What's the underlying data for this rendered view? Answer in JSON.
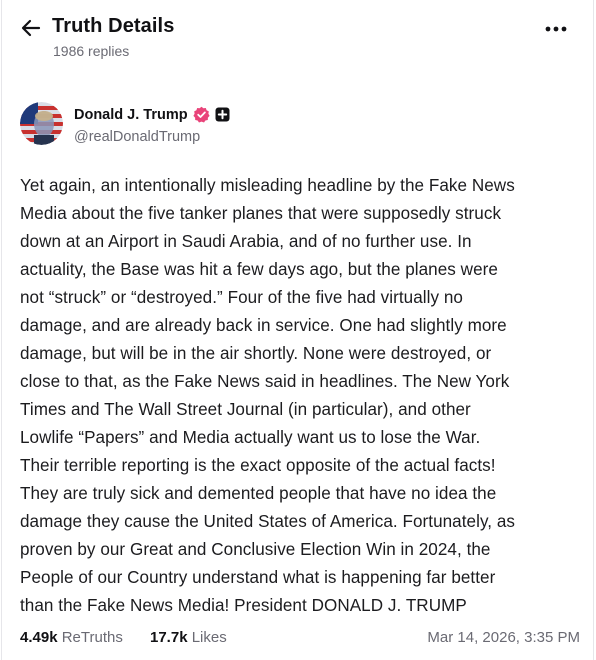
{
  "header": {
    "title": "Truth Details",
    "reply_count": "1986 replies"
  },
  "author": {
    "name": "Donald J. Trump",
    "handle": "@realDonaldTrump"
  },
  "post": {
    "lines": [
      "Yet again, an intentionally misleading headline by the Fake News",
      "Media about the five tanker planes that were supposedly struck",
      "down at an Airport in Saudi Arabia, and of no further use. In",
      "actuality, the Base was hit a few days ago, but the planes were",
      "not “struck” or “destroyed.” Four of the five had virtually no",
      "damage, and are already back in service. One had slightly more",
      "damage, but will be in the air shortly. None were destroyed, or",
      "close to that, as the Fake News said in headlines. The New York",
      "Times and The Wall Street Journal (in particular), and other",
      "Lowlife “Papers” and Media actually want us to lose the War.",
      "Their terrible reporting is the exact opposite of the actual facts!",
      "They are truly sick and demented people that have no idea the",
      "damage they cause the United States of America. Fortunately, as",
      "proven by our Great and Conclusive Election Win in 2024, the",
      "People of our Country understand what is happening far better",
      "than the Fake News Media! President DONALD J. TRUMP"
    ]
  },
  "stats": {
    "retruths_count": "4.49k",
    "retruths_label": "ReTruths",
    "likes_count": "17.7k",
    "likes_label": "Likes",
    "timestamp": "Mar 14, 2026, 3:35 PM"
  },
  "icons": {
    "back": "arrow-left-icon",
    "more": "more-horizontal-icon",
    "verified": "verified-badge-icon",
    "affiliation": "plus-badge-icon"
  },
  "colors": {
    "verified_badge": "#e9447a",
    "text_primary": "#1c1c1f",
    "text_secondary": "#6a6a73"
  }
}
